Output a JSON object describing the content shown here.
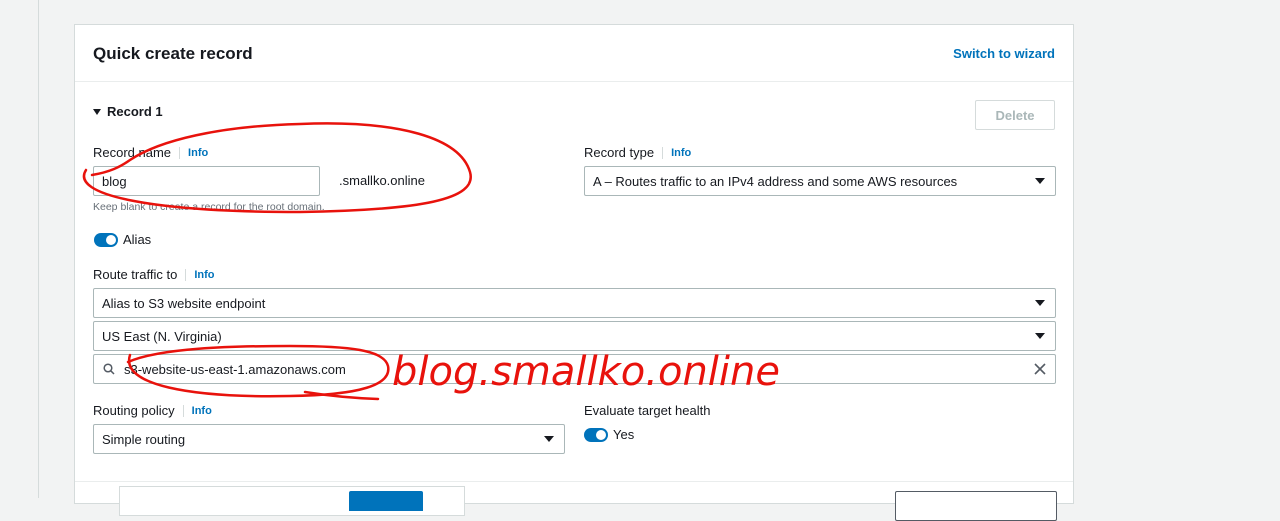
{
  "panel": {
    "title": "Quick create record",
    "switch_link": "Switch to wizard"
  },
  "record": {
    "section_label": "Record 1",
    "delete_label": "Delete",
    "record_name": {
      "label": "Record name",
      "info": "Info",
      "value": "blog",
      "suffix": ".smallko.online",
      "hint": "Keep blank to create a record for the root domain."
    },
    "record_type": {
      "label": "Record type",
      "info": "Info",
      "value": "A – Routes traffic to an IPv4 address and some AWS resources"
    },
    "alias": {
      "label": "Alias",
      "enabled": true
    },
    "route_traffic": {
      "label": "Route traffic to",
      "info": "Info",
      "endpoint_type": "Alias to S3 website endpoint",
      "region": "US East (N. Virginia)",
      "endpoint_value": "s3-website-us-east-1.amazonaws.com"
    },
    "routing_policy": {
      "label": "Routing policy",
      "info": "Info",
      "value": "Simple routing"
    },
    "evaluate_health": {
      "label": "Evaluate target health",
      "toggle_label": "Yes",
      "enabled": true
    }
  },
  "annotation": {
    "handwritten_text": "blog.smallko.online",
    "color": "#e8120c"
  },
  "colors": {
    "accent": "#0073bb",
    "border": "#aab7b8"
  }
}
